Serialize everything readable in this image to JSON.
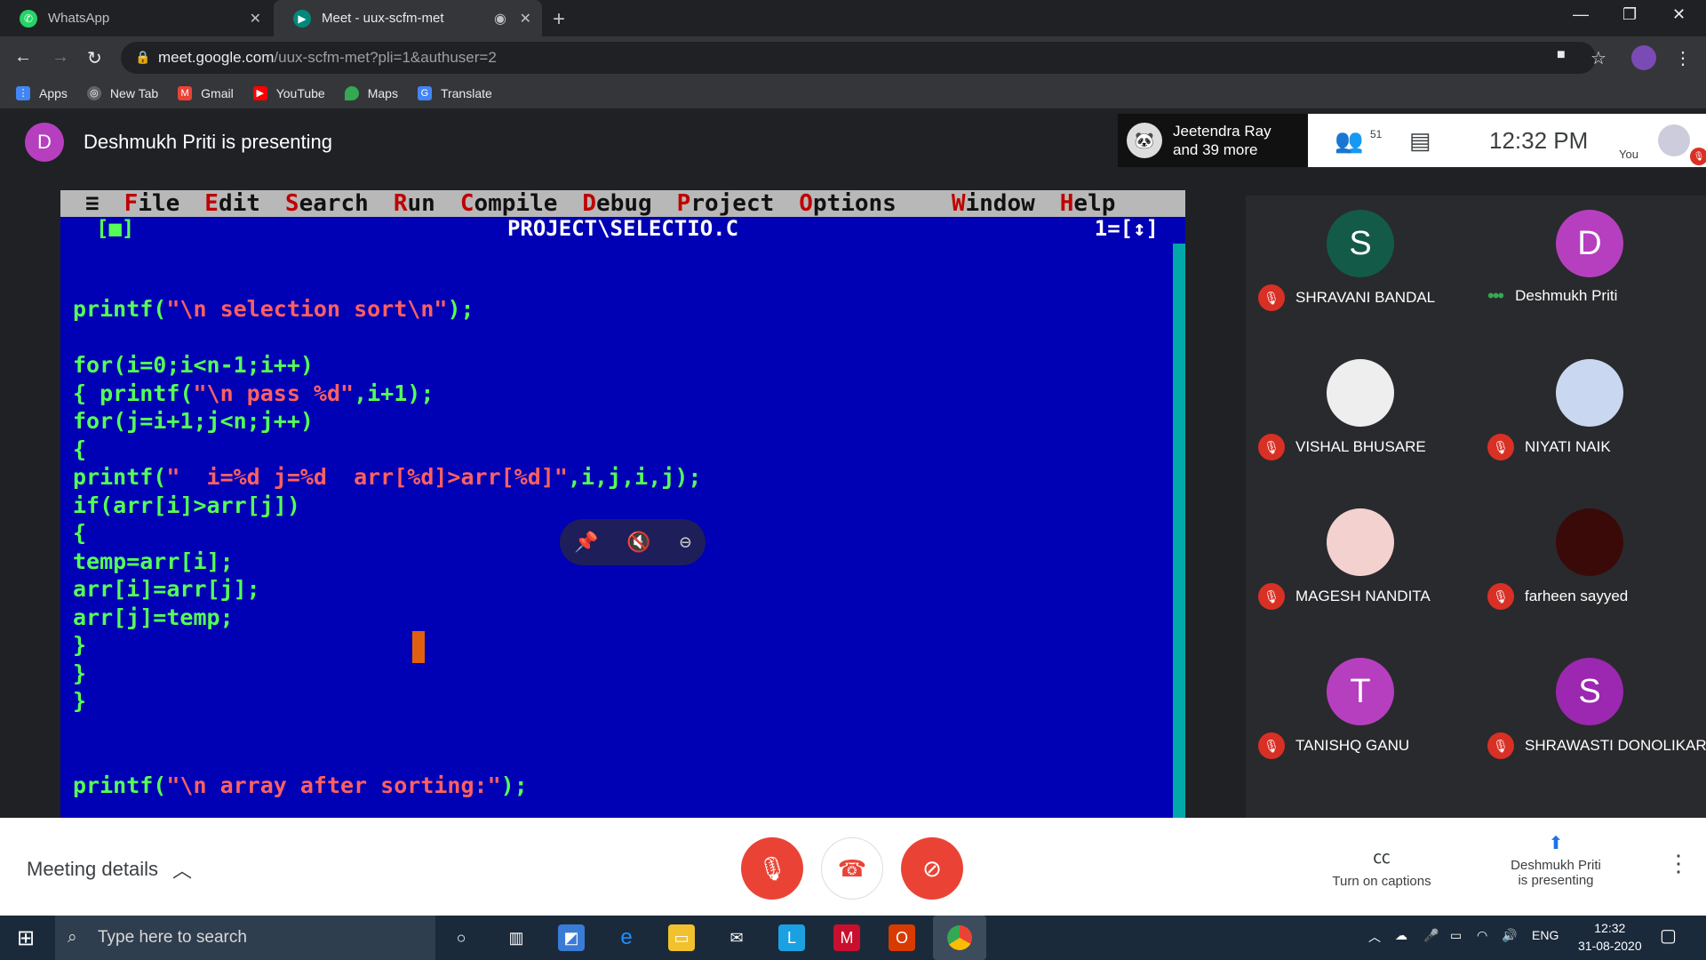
{
  "browser": {
    "tabs": [
      {
        "title": "WhatsApp",
        "icon": "whatsapp-icon"
      },
      {
        "title": "Meet - uux-scfm-met",
        "icon": "meet-icon"
      }
    ],
    "url_host": "meet.google.com",
    "url_path": "/uux-scfm-met?pli=1&authuser=2",
    "bookmarks": [
      "Apps",
      "New Tab",
      "Gmail",
      "YouTube",
      "Maps",
      "Translate"
    ]
  },
  "meet": {
    "presenter_initial": "D",
    "presenter_text": "Deshmukh Priti is presenting",
    "host_line1": "Jeetendra Ray",
    "host_line2": "and 39 more",
    "participants_count": "51",
    "time": "12:32  PM",
    "you_label": "You",
    "participants": [
      {
        "initial": "S",
        "name": "SHRAVANI BANDAL",
        "color": "#135a48",
        "muted": true
      },
      {
        "initial": "D",
        "name": "Deshmukh Priti",
        "color": "#b63fbf",
        "muted": false
      },
      {
        "initial": "",
        "name": "VISHAL BHUSARE",
        "color": "#eeeeee",
        "muted": true
      },
      {
        "initial": "",
        "name": "NIYATI NAIK",
        "color": "#c9d7f0",
        "muted": true
      },
      {
        "initial": "",
        "name": "MAGESH NANDITA",
        "color": "#f3d1cf",
        "muted": true
      },
      {
        "initial": "",
        "name": "farheen sayyed",
        "color": "#3a0a08",
        "muted": true
      },
      {
        "initial": "T",
        "name": "TANISHQ GANU",
        "color": "#b63fbf",
        "muted": true
      },
      {
        "initial": "S",
        "name": "SHRAWASTI DONOLIKAR",
        "color": "#9c27b0",
        "muted": true
      }
    ]
  },
  "turboc": {
    "menu": [
      "File",
      "Edit",
      "Search",
      "Run",
      "Compile",
      "Debug",
      "Project",
      "Options",
      "Window",
      "Help"
    ],
    "title_left": "[■]",
    "title": "PROJECT\\SELECTIO.C",
    "title_right": "1=[↕]",
    "code": [
      [
        "printf(\"\\n selection sort\\n\");"
      ],
      [
        ""
      ],
      [
        "for(i=0;i<n-1;i++)"
      ],
      [
        "{ printf(\"\\n pass %d\",i+1);"
      ],
      [
        "for(j=i+1;j<n;j++)"
      ],
      [
        "{"
      ],
      [
        "printf(\"  i=%d j=%d  arr[%d]>arr[%d]\",i,j,i,j);"
      ],
      [
        "if(arr[i]>arr[j])"
      ],
      [
        "{"
      ],
      [
        "temp=arr[i];"
      ],
      [
        "arr[i]=arr[j];"
      ],
      [
        "arr[j]=temp;"
      ],
      [
        "}"
      ],
      [
        "}"
      ],
      [
        "}"
      ],
      [
        ""
      ],
      [
        ""
      ],
      [
        "printf(\"\\n array after sorting:\");"
      ]
    ]
  },
  "controls": {
    "meeting_details": "Meeting details",
    "captions": "Turn on captions",
    "present_line1": "Deshmukh Priti",
    "present_line2": "is presenting"
  },
  "taskbar": {
    "search_placeholder": "Type here to search",
    "lang": "ENG",
    "time": "12:32",
    "date": "31-08-2020"
  }
}
